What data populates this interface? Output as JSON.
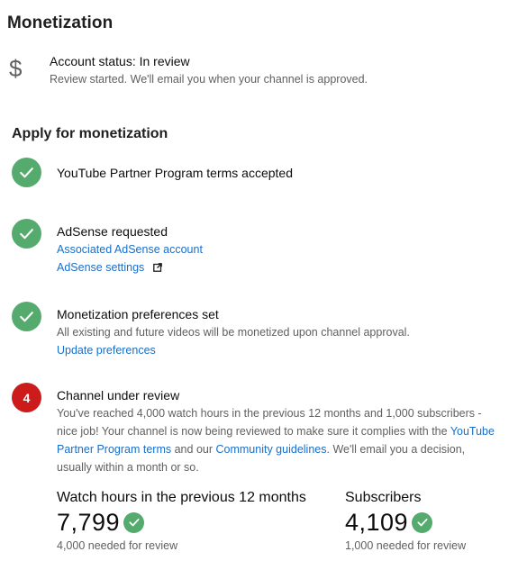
{
  "page": {
    "title": "Monetization"
  },
  "status": {
    "icon": "dollar-icon",
    "glyph": "$",
    "title": "Account status: In review",
    "subtitle": "Review started. We'll email you when your channel is approved."
  },
  "apply": {
    "title": "Apply for monetization",
    "steps": [
      {
        "state": "done",
        "title": "YouTube Partner Program terms accepted"
      },
      {
        "state": "done",
        "title": "AdSense requested",
        "links": [
          "Associated AdSense account",
          "AdSense settings"
        ]
      },
      {
        "state": "done",
        "title": "Monetization preferences set",
        "text": "All existing and future videos will be monetized upon channel approval.",
        "link": "Update preferences"
      },
      {
        "state": "pending",
        "number": "4",
        "title": "Channel under review",
        "text_1": "You've reached 4,000 watch hours in the previous 12 months and 1,000 subscribers - nice job! Your channel is now being reviewed to make sure it complies with the",
        "link_terms": "YouTube Partner Program terms",
        "text_2": "and our",
        "link_guidelines": "Community guidelines",
        "text_3": ".",
        "text_4": "We'll email you a decision, usually within a month or so."
      }
    ]
  },
  "metrics": [
    {
      "label": "Watch hours in the previous 12 months",
      "value": "7,799",
      "note": "4,000 needed for review"
    },
    {
      "label": "Subscribers",
      "value": "4,109",
      "note": "1,000 needed for review"
    }
  ],
  "colors": {
    "success": "#55ab6e",
    "pending": "#cc1b1b",
    "link": "#1a6fc9",
    "secondary_text": "#606060"
  }
}
